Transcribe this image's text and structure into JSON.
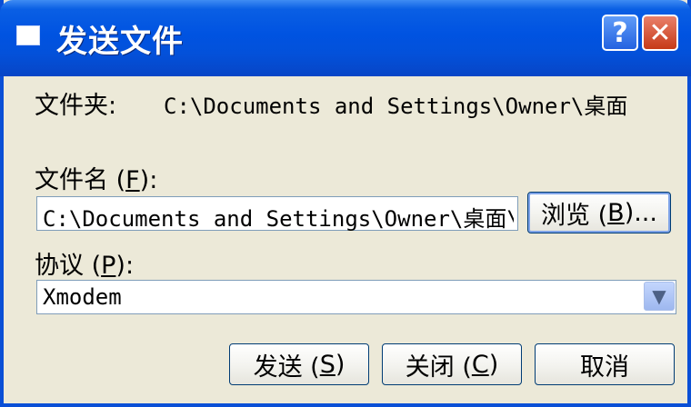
{
  "window": {
    "title": "发送文件",
    "help_symbol": "?",
    "close_symbol": "✕"
  },
  "folder": {
    "label": "文件夹:",
    "value": "C:\\Documents and Settings\\Owner\\桌面"
  },
  "filename": {
    "label_prefix": "文件名 (",
    "label_key": "F",
    "label_suffix": "):",
    "value": "C:\\Documents and Settings\\Owner\\桌面\\lec",
    "browse_prefix": "浏览 (",
    "browse_key": "B",
    "browse_suffix": ")..."
  },
  "protocol": {
    "label_prefix": "协议 (",
    "label_key": "P",
    "label_suffix": "):",
    "selected": "Xmodem"
  },
  "buttons": {
    "send_prefix": "发送 (",
    "send_key": "S",
    "send_suffix": ")",
    "close_prefix": "关闭 (",
    "close_key": "C",
    "close_suffix": ")",
    "cancel": "取消"
  },
  "colors": {
    "titlebar": "#0053e1",
    "dialog_bg": "#ece9d8",
    "close_button": "#c63a18"
  },
  "icons": [
    "window-icon",
    "help-icon",
    "close-icon",
    "chevron-down-icon"
  ]
}
